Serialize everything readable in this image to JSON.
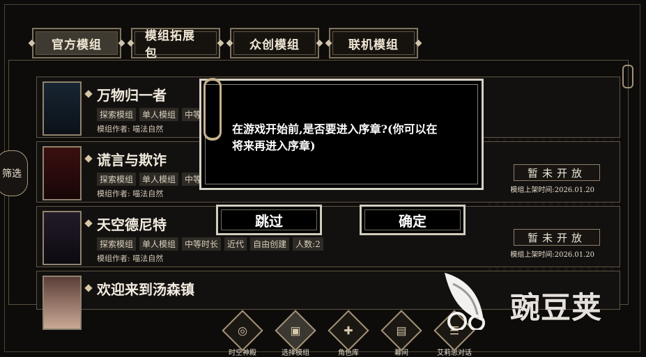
{
  "tabs": [
    "官方模组",
    "模组拓展包",
    "众创模组",
    "联机模组"
  ],
  "filter_label": "筛选",
  "cards": [
    {
      "title": "万物归一者",
      "tags": [
        "探索模组",
        "单人模组",
        "中等"
      ],
      "author": "模组作者: 喵法自然"
    },
    {
      "title": "谎言与欺诈",
      "tags": [
        "探索模组",
        "单人模组",
        "中等"
      ],
      "author": "模组作者: 喵法自然",
      "status": "暂未开放",
      "release": "模组上架时间:2026.01.20"
    },
    {
      "title": "天空德尼特",
      "tags": [
        "探索模组",
        "单人模组",
        "中等时长",
        "近代",
        "自由创建",
        "人数:2"
      ],
      "author": "模组作者: 喵法自然",
      "status": "暂未开放",
      "release": "模组上架时间:2026.01.20"
    },
    {
      "title": "欢迎来到汤森镇",
      "tags": [],
      "author": ""
    }
  ],
  "modal": {
    "text": "在游戏开始前,是否要进入序章?(你可以在将来再进入序章)",
    "skip": "跳过",
    "confirm": "确定"
  },
  "bottom_nav": [
    {
      "label": "时空神殿",
      "icon": "target-icon"
    },
    {
      "label": "选择模组",
      "icon": "cards-icon"
    },
    {
      "label": "角色库",
      "icon": "character-icon"
    },
    {
      "label": "幕间",
      "icon": "stage-icon"
    },
    {
      "label": "艾莉思对话",
      "icon": "chat-icon"
    }
  ],
  "watermark": "豌豆荚"
}
